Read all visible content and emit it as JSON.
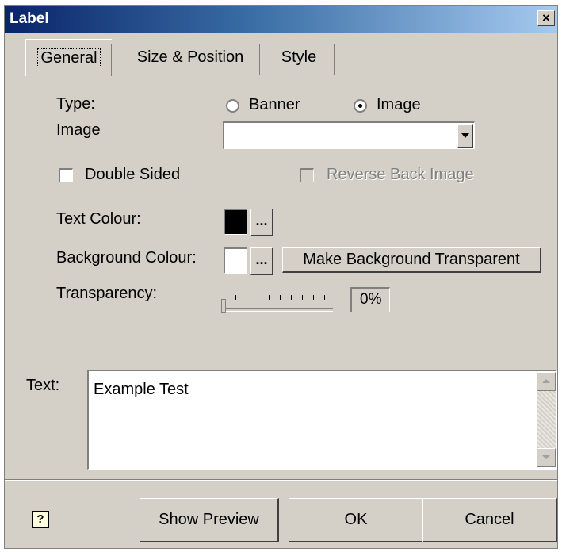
{
  "window": {
    "title": "Label",
    "close_glyph": "×"
  },
  "tabs": [
    {
      "label": "General",
      "active": true
    },
    {
      "label": "Size & Position",
      "active": false
    },
    {
      "label": "Style",
      "active": false
    }
  ],
  "general": {
    "type_label": "Type:",
    "radio_banner_label": "Banner",
    "radio_image_label": "Image",
    "selected_type": "Image",
    "image_label": "Image",
    "image_value": "",
    "double_sided_label": "Double Sided",
    "double_sided_checked": false,
    "reverse_back_label": "Reverse Back Image",
    "reverse_back_checked": false,
    "text_colour_label": "Text Colour:",
    "text_colour": "#000000",
    "bg_colour_label": "Background Colour:",
    "bg_colour": "#ffffff",
    "ellipsis": "...",
    "make_transparent_label": "Make Background Transparent",
    "transparency_label": "Transparency:",
    "transparency_value": "0%",
    "text_label": "Text:",
    "text_value": "Example Test"
  },
  "footer": {
    "help_icon": "help-icon",
    "show_preview_label": "Show Preview",
    "ok_label": "OK",
    "cancel_label": "Cancel"
  },
  "colors": {
    "title_start": "#0a246a",
    "title_end": "#a6caf0",
    "face": "#d4d0c8"
  }
}
